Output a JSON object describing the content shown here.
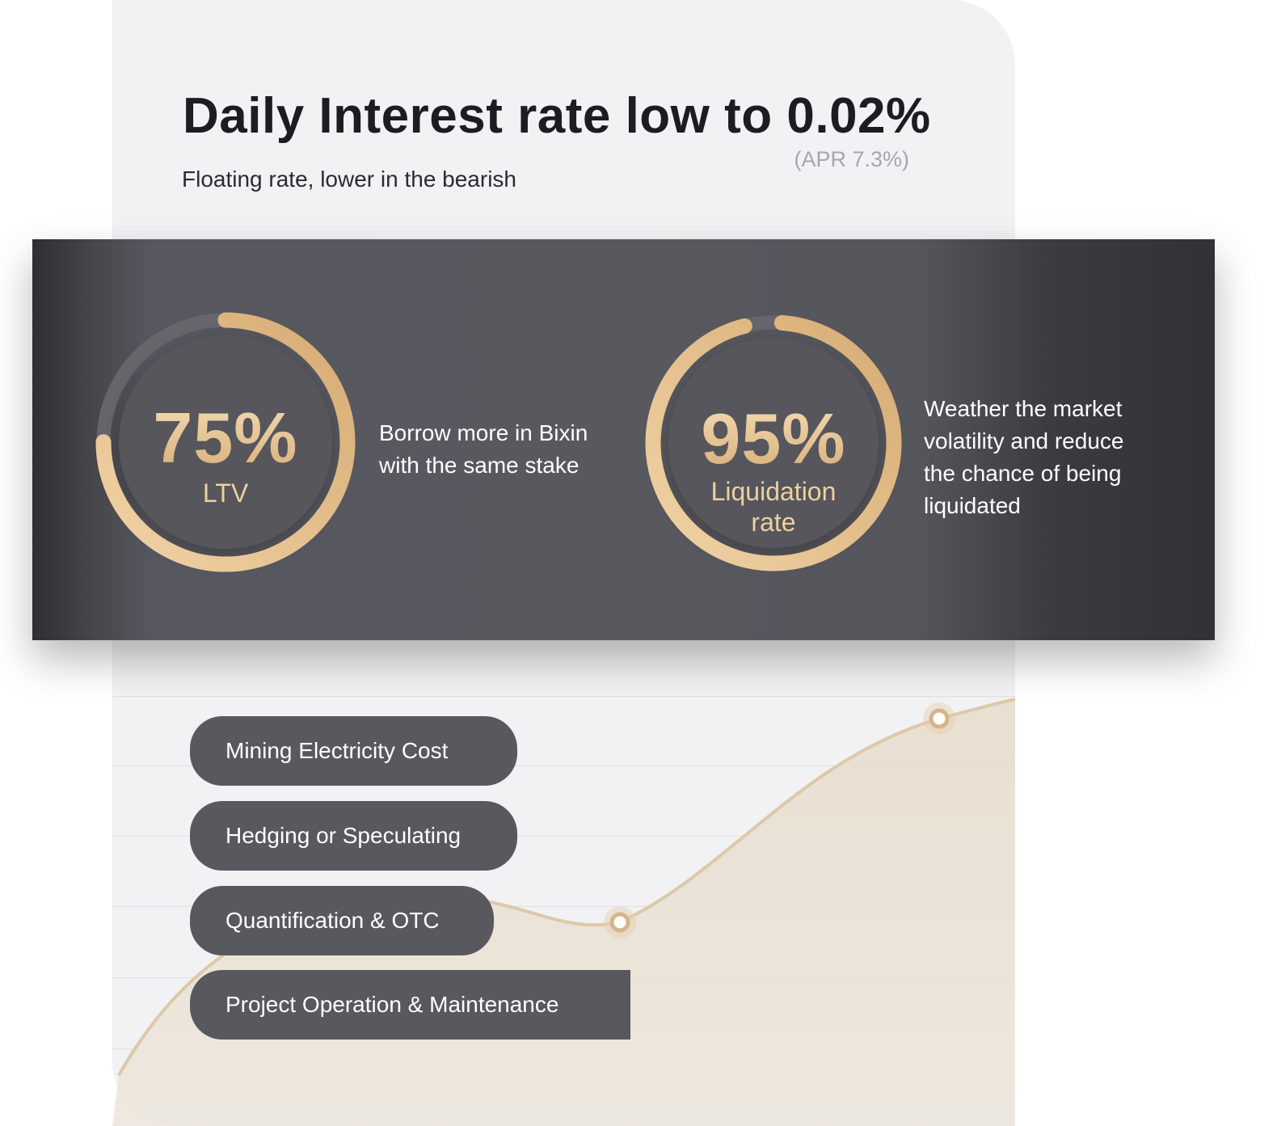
{
  "headline": "Daily Interest rate low to 0.02%",
  "apr": "(APR 7.3%)",
  "subhead": "Floating rate, lower in the bearish",
  "metrics": [
    {
      "value": "75%",
      "label": "LTV",
      "fraction": 0.75,
      "description_lines": [
        "Borrow more in Bixin",
        "with the same stake"
      ]
    },
    {
      "value": "95%",
      "label_lines": [
        "Liquidation",
        "rate"
      ],
      "fraction": 0.95,
      "description_lines": [
        "Weather the market",
        "volatility and reduce",
        "the chance of being",
        "liquidated"
      ]
    }
  ],
  "use_cases": [
    "Mining Electricity Cost",
    "Hedging or Speculating",
    "Quantification & OTC",
    "Project Operation & Maintenance"
  ],
  "colors": {
    "gold_light": "#f3d9b0",
    "gold_dark": "#d8b07a",
    "band": "#58585f",
    "pill": "#58585e",
    "card_bg": "#f2f2f4"
  }
}
